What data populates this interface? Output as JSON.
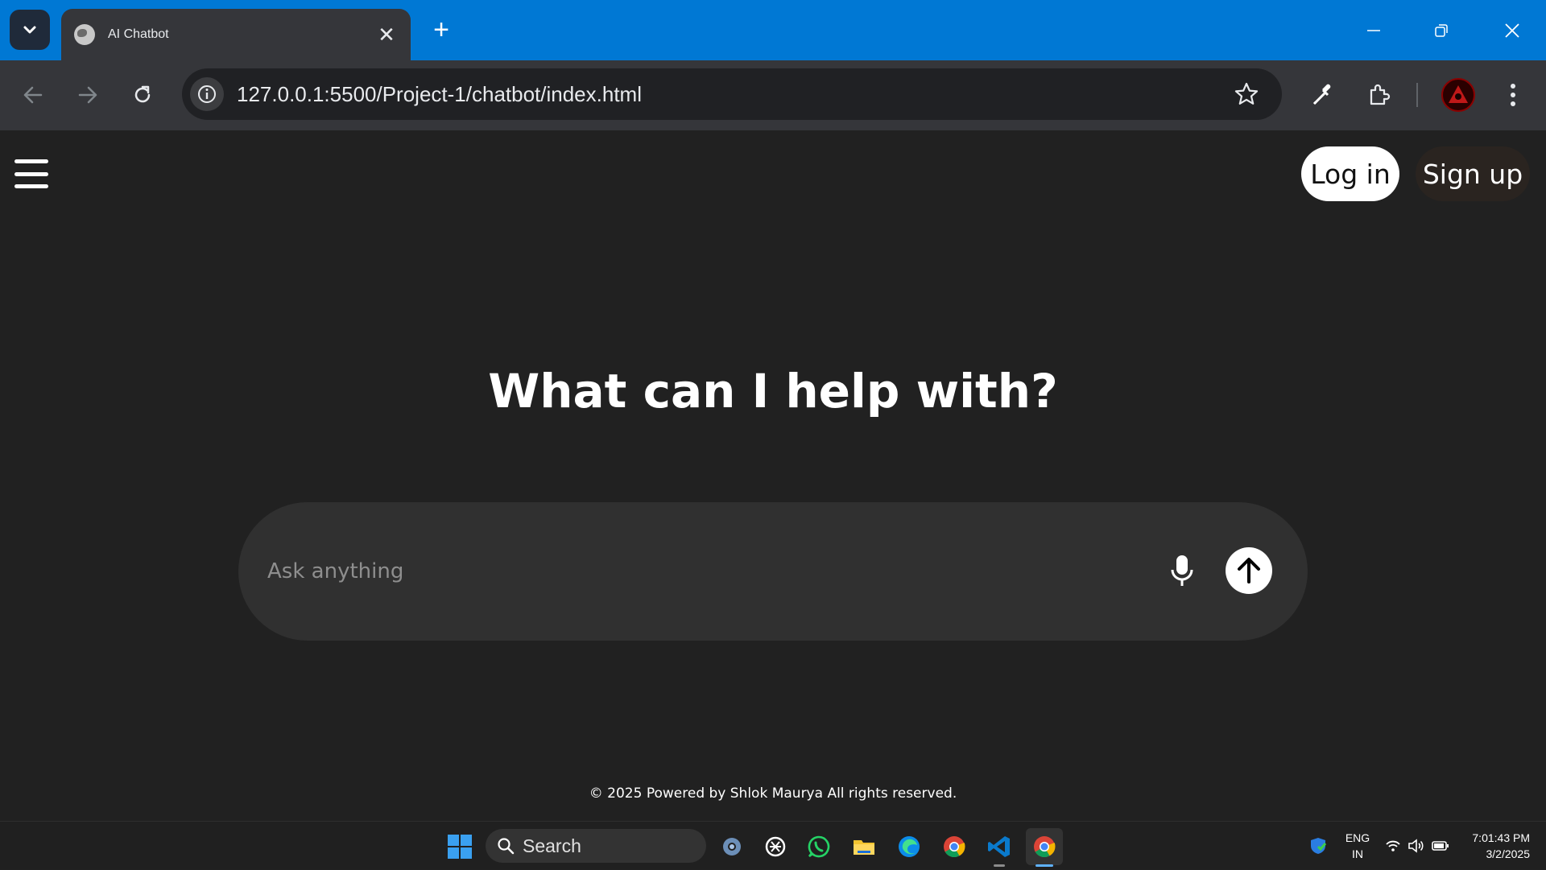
{
  "browser": {
    "tab_title": "AI Chatbot",
    "url": "127.0.0.1:5500/Project-1/chatbot/index.html",
    "icons": [
      "tab-search-icon",
      "globe-favicon-icon",
      "close-icon",
      "plus-icon",
      "minimize-icon",
      "restore-icon",
      "window-close-icon",
      "back-arrow-icon",
      "forward-arrow-icon",
      "reload-icon",
      "site-info-icon",
      "bookmark-star-icon",
      "eyedropper-icon",
      "extensions-icon",
      "profile-avatar",
      "kebab-menu-icon"
    ]
  },
  "page": {
    "login_label": "Log in",
    "signup_label": "Sign up",
    "headline": "What can I help with?",
    "input_placeholder": "Ask anything",
    "footer": "© 2025 Powered by Shlok Maurya All rights reserved.",
    "icons": [
      "hamburger-menu-icon",
      "microphone-icon",
      "send-arrow-icon"
    ]
  },
  "taskbar": {
    "search_label": "Search",
    "lang_line1": "ENG",
    "lang_line2": "IN",
    "time": "7:01:43 PM",
    "date": "3/2/2025",
    "apps": [
      "windows-start-icon",
      "settings-icon",
      "chatgpt-icon",
      "whatsapp-icon",
      "file-explorer-icon",
      "edge-icon",
      "chrome-icon",
      "vscode-icon",
      "chrome-active-icon"
    ],
    "tray": [
      "security-shield-icon",
      "wifi-icon",
      "volume-icon",
      "battery-icon"
    ],
    "colors": {
      "accent": "#0078d4",
      "page_bg": "#212121",
      "composer_bg": "#303030"
    }
  }
}
